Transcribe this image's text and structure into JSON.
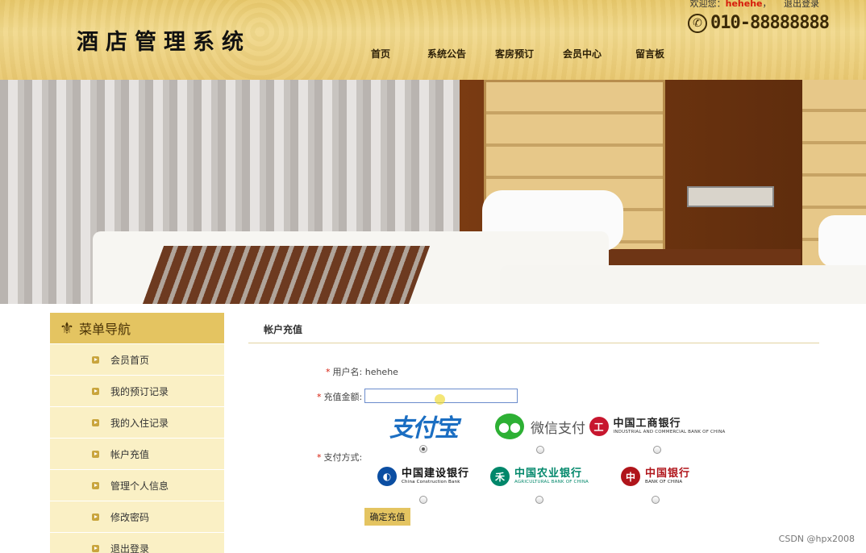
{
  "header": {
    "logo": "酒店管理系统",
    "welcome_prefix": "欢迎您：",
    "username": "hehehe",
    "comma": "，",
    "logout": "退出登录",
    "phone": "010-88888888",
    "nav": [
      "首页",
      "系统公告",
      "客房预订",
      "会员中心",
      "留言板"
    ]
  },
  "sidebar": {
    "title": "菜单导航",
    "items": [
      "会员首页",
      "我的预订记录",
      "我的入住记录",
      "帐户充值",
      "管理个人信息",
      "修改密码",
      "退出登录"
    ]
  },
  "content": {
    "title": "帐户充值",
    "username_label": "用户名:",
    "username_value": "hehehe",
    "amount_label": "充值金额:",
    "amount_value": "",
    "payment_label": "支付方式:",
    "submit": "确定充值"
  },
  "payment_methods": [
    {
      "id": "alipay",
      "name": "支付宝",
      "checked": true
    },
    {
      "id": "wechat",
      "name": "微信支付",
      "checked": false
    },
    {
      "id": "icbc",
      "name": "中国工商银行",
      "en": "INDUSTRIAL AND COMMERCIAL BANK OF CHINA",
      "checked": false
    },
    {
      "id": "ccb",
      "name": "中国建设银行",
      "en": "China Construction Bank",
      "checked": false
    },
    {
      "id": "abc",
      "name": "中国农业银行",
      "en": "AGRICULTURAL BANK OF CHINA",
      "checked": false
    },
    {
      "id": "boc",
      "name": "中国银行",
      "en": "BANK OF CHINA",
      "checked": false
    }
  ],
  "colors": {
    "accent": "#e4c461",
    "required": "#d61b0a",
    "icbc": "#c7162e",
    "ccb": "#0b4ea2",
    "abc": "#00876a",
    "boc": "#b0151b"
  },
  "watermark": "CSDN @hpx2008"
}
